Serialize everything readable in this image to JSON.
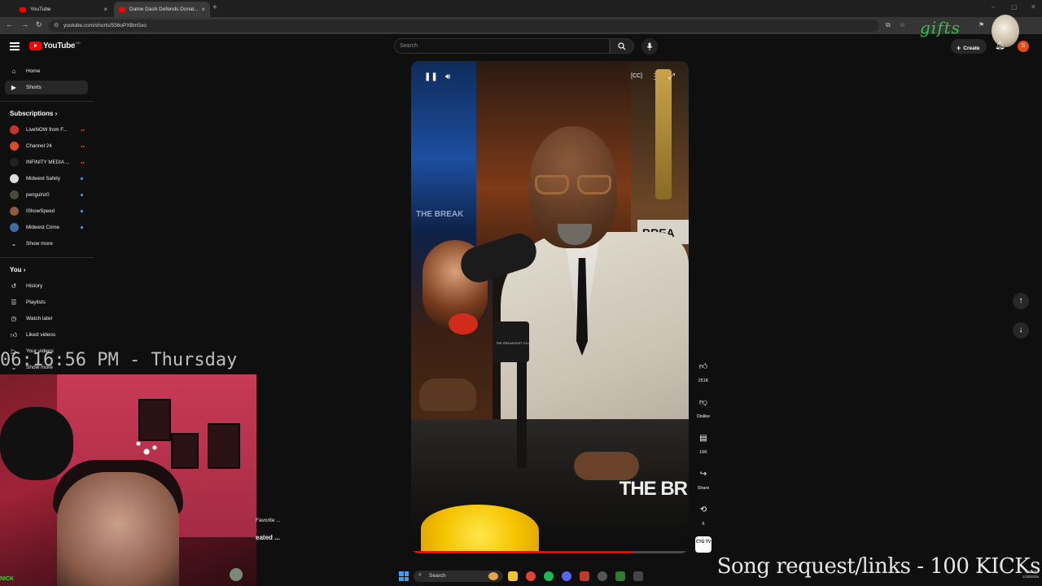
{
  "browser": {
    "tabs": [
      {
        "label": "YouTube"
      },
      {
        "label": "Dame Dash Defends Donal..."
      }
    ],
    "url": "youtube.com/shorts/556oPXBm5xo"
  },
  "overlay_brand": "gifts",
  "youtube": {
    "logo_text": "YouTube",
    "logo_country": "BD",
    "search_placeholder": "Search",
    "create_label": "Create",
    "profile_initial": "S"
  },
  "sidebar": {
    "nav": [
      {
        "label": "Home",
        "icon": "home-icon"
      },
      {
        "label": "Shorts",
        "icon": "shorts-icon"
      }
    ],
    "subscriptions_heading": "Subscriptions",
    "subscriptions": [
      {
        "label": "LiveNOW from F...",
        "color": "#c7322c",
        "indicator": "live"
      },
      {
        "label": "Channel 24",
        "color": "#d84a2a",
        "indicator": "live"
      },
      {
        "label": "INFINITY MEDIA ...",
        "color": "#222222",
        "indicator": "live"
      },
      {
        "label": "Midwest Safety",
        "color": "#dcdcdc",
        "indicator": "dot"
      },
      {
        "label": "penguinz0",
        "color": "#4a4a3a",
        "indicator": "dot"
      },
      {
        "label": "IShowSpeed",
        "color": "#8b5a3c",
        "indicator": "dot"
      },
      {
        "label": "Midwest Crime",
        "color": "#3a6ea5",
        "indicator": "dot"
      }
    ],
    "show_more": "Show more",
    "you_heading": "You",
    "you_items": [
      {
        "label": "History",
        "icon": "history-icon"
      },
      {
        "label": "Playlists",
        "icon": "playlists-icon"
      },
      {
        "label": "Watch later",
        "icon": "watch-later-icon"
      },
      {
        "label": "Liked videos",
        "icon": "liked-videos-icon"
      },
      {
        "label": "Your videos",
        "icon": "your-videos-icon"
      }
    ],
    "show_more_2": "Show more"
  },
  "short": {
    "watermark": "THE BR",
    "bg_sign_right": "BREA",
    "bg_sign_left": "THE BREAK",
    "mic_label": "THE BREAKFAST CLUB",
    "progress": 0.8
  },
  "actions": {
    "like_count": "251K",
    "dislike_label": "Dislike",
    "comment_count": "16K",
    "share_label": "Share",
    "remix_count": "6",
    "channel_badge": "CTG TV"
  },
  "overlays": {
    "clock": "06:16:56 PM - Thursday",
    "cam_name": "NICK",
    "side_text_1": "Favorite ...",
    "side_text_2": "eated ...",
    "song_request": "Song request/links - 100 KICKs"
  },
  "taskbar": {
    "search_label": "Search",
    "time": "6:16 PM",
    "date": "1/15/2026"
  }
}
